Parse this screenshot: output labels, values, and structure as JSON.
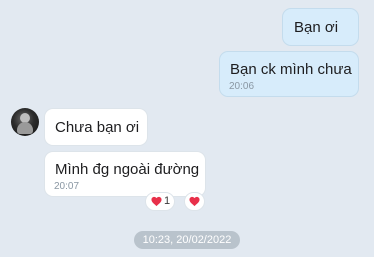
{
  "messages": [
    {
      "direction": "outgoing",
      "text": "Bạn ơi",
      "time": ""
    },
    {
      "direction": "outgoing",
      "text": "Bạn ck mình chưa",
      "time": "20:06"
    },
    {
      "direction": "incoming",
      "text": "Chưa bạn ơi",
      "time": ""
    },
    {
      "direction": "incoming",
      "text": "Mình đg ngoài đường",
      "time": "20:07"
    }
  ],
  "reactions": [
    {
      "icon": "heart-icon",
      "count": "1",
      "color": "#e8304a"
    },
    {
      "icon": "heart-icon",
      "count": "",
      "color": "#e8304a"
    }
  ],
  "date_separator": "10:23, 20/02/2022",
  "colors": {
    "background": "#e2e9f1",
    "outgoing_bubble": "#d7ecfb",
    "incoming_bubble": "#ffffff",
    "timestamp_text": "#8a97a3"
  }
}
